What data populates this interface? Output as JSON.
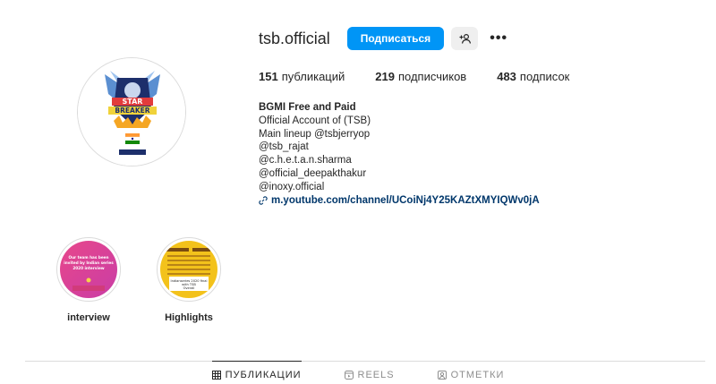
{
  "profile": {
    "username": "tsb.official",
    "follow_label": "Подписаться",
    "suggest_icon": "person-add-icon",
    "more_label": "•••"
  },
  "stats": [
    {
      "value": "151",
      "label": "публикаций"
    },
    {
      "value": "219",
      "label": "подписчиков"
    },
    {
      "value": "483",
      "label": "подписок"
    }
  ],
  "bio": {
    "name": "BGMI Free and Paid",
    "lines": [
      "Official Account of (TSB)",
      "Main lineup @tsbjerryop",
      "@tsb_rajat",
      "@c.h.e.t.a.n.sharma",
      "@official_deepakthakur",
      "@inoxy.official"
    ],
    "link": "m.youtube.com/channel/UCoiNj4Y25KAZtXMYIQWv0jA"
  },
  "avatar": {
    "logo_lines": [
      "STAR",
      "BREAKER"
    ]
  },
  "highlights": [
    {
      "label": "interview",
      "cover_text": [
        "Our team has been",
        "invited by Indian series",
        "2020 interview"
      ]
    },
    {
      "label": "Highlights",
      "cover_text": [
        "Indianseries 2020 final",
        "with TSB",
        "Overall"
      ]
    }
  ],
  "tabs": [
    {
      "label": "ПУБЛИКАЦИИ",
      "icon": "grid-icon",
      "active": true
    },
    {
      "label": "REELS",
      "icon": "reels-icon",
      "active": false
    },
    {
      "label": "ОТМЕТКИ",
      "icon": "tagged-icon",
      "active": false
    }
  ],
  "colors": {
    "accent": "#0095f6",
    "link": "#00376b",
    "text": "#262626",
    "muted": "#8e8e8e",
    "border": "#dbdbdb"
  }
}
